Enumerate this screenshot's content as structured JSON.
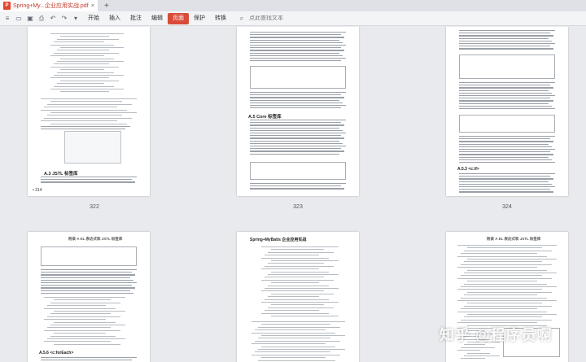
{
  "window": {
    "tab_title": "Spring+My...企业应用实战.pdf",
    "tab_close": "×",
    "new_tab": "+"
  },
  "toolbar": {
    "menu": [
      "开始",
      "插入",
      "批注",
      "编辑",
      "页面",
      "保护",
      "转换"
    ],
    "active_menu": "页面",
    "search_placeholder": "点此查找文本"
  },
  "pages": {
    "top_row": [
      {
        "number": "322",
        "footer": "▪ 314",
        "section": "A.3 JSTL 标签库"
      },
      {
        "number": "323",
        "footer": "",
        "section": "A.5 Core 标签库"
      },
      {
        "number": "324",
        "footer": "",
        "section": "A.5.3 <c:if>"
      }
    ],
    "bottom_row": [
      {
        "header": "附录 A  EL 表达式和 JSTL 标签库",
        "section": "A.5.6 <c:forEach>"
      },
      {
        "header": "Spring+MyBatis 企业应用实战"
      },
      {
        "header": "附录 A  EL 表达式和 JSTL 标签库"
      }
    ]
  },
  "watermark": "知乎 @程序员啊",
  "colors": {
    "accent": "#d94a3a",
    "pdf": "#e2472f"
  }
}
